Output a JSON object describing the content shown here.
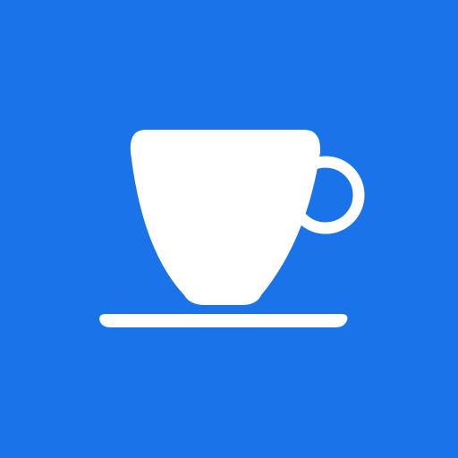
{
  "icon": {
    "name": "coffee-cup-icon",
    "colors": {
      "background": "#1A73E8",
      "foreground": "#FFFFFF"
    }
  }
}
